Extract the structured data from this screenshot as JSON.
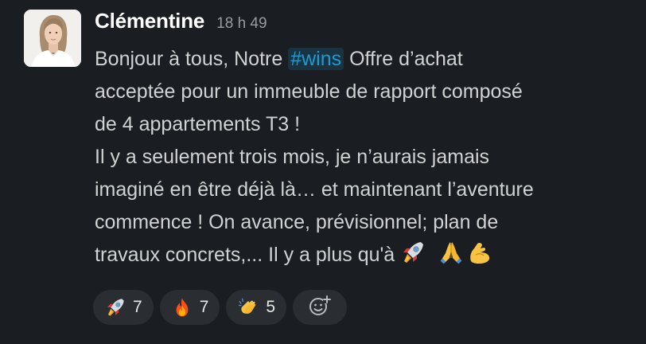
{
  "message": {
    "author": "Clémentine",
    "timestamp": "18 h 49",
    "lines": [
      {
        "pre": "Bonjour à tous, Notre ",
        "hashtag": "#wins",
        "post": " Offre d’achat"
      },
      "acceptée pour un immeuble de rapport composé",
      "de 4 appartements T3 !",
      "Il y a seulement trois mois, je n’aurais jamais",
      "imaginé en être déjà là… et maintenant l’aventure",
      "commence ! On avance, prévisionnel; plan de",
      "travaux concrets,... Il y a plus qu'à"
    ],
    "inline_emojis": [
      "rocket-icon",
      "folded-hands-icon",
      "flexed-biceps-icon"
    ]
  },
  "reactions": [
    {
      "emoji": "rocket-icon",
      "count": "7"
    },
    {
      "emoji": "fire-icon",
      "count": "7"
    },
    {
      "emoji": "clapping-hands-icon",
      "count": "5"
    }
  ],
  "add_reaction": {
    "icon": "add-reaction-icon"
  },
  "colors": {
    "background": "#1a1d21",
    "text": "#d1d2d3",
    "author": "#ffffff",
    "timestamp": "#9a9b9d",
    "hashtag": "#1d9bd1",
    "reaction_bg": "#2a2d31"
  }
}
